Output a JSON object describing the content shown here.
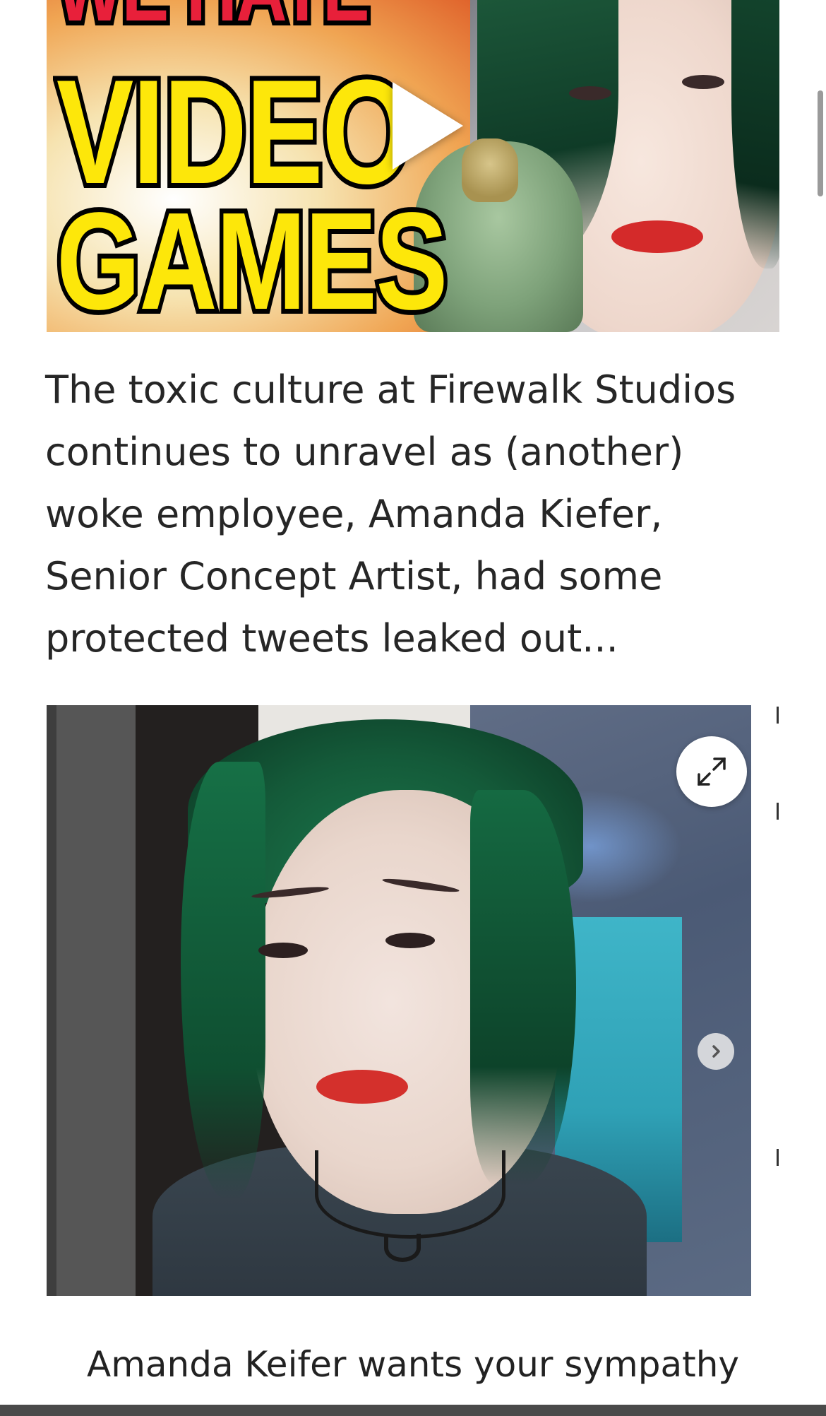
{
  "video": {
    "thumbnail_lines": [
      "WE HATE",
      "VIDEO",
      "GAMES"
    ],
    "play_icon": "play-icon"
  },
  "article": {
    "paragraph": "The toxic culture at Firewalk Studios continues to unravel as (another) woke employee, Amanda Kiefer, Senior Concept Artist, had some protected tweets leaked out..."
  },
  "gallery": {
    "expand_icon": "expand-icon",
    "next_icon": "chevron-right-icon",
    "caption": "Amanda Keifer wants your sympathy"
  },
  "colors": {
    "background": "#ffffff",
    "text": "#262626",
    "thumbnail_yellow": "#fde70a",
    "thumbnail_red": "#e8203a"
  }
}
